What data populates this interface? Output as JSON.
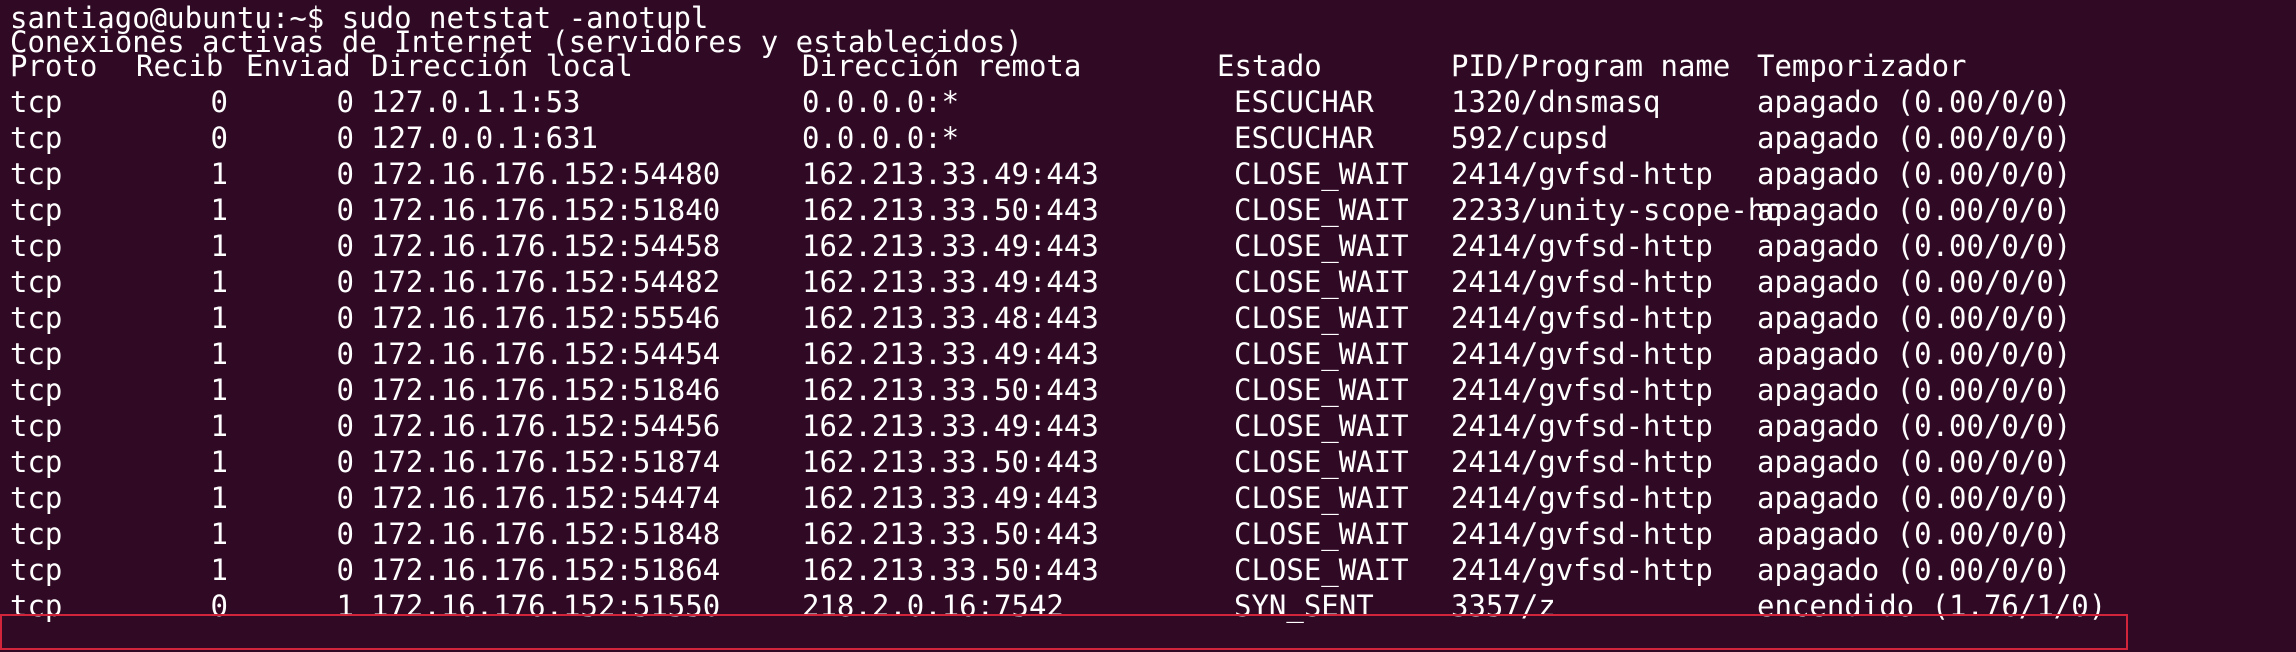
{
  "prompt": "santiago@ubuntu:~$ sudo netstat -anotupl",
  "header_line": "Conexiones activas de Internet (servidores y establecidos)",
  "columns": {
    "proto": "Proto",
    "recib": "Recib",
    "enviad": "Enviad",
    "local": "Dirección local",
    "remote": "Dirección remota",
    "state": "Estado",
    "pid": "PID/Program name",
    "timer": "Temporizador"
  },
  "rows": [
    {
      "proto": "tcp",
      "recib": "0",
      "enviad": "0",
      "local": "127.0.1.1:53",
      "remote": "0.0.0.0:*",
      "state": "ESCUCHAR",
      "pid": "1320/dnsmasq",
      "timer": "apagado (0.00/0/0)"
    },
    {
      "proto": "tcp",
      "recib": "0",
      "enviad": "0",
      "local": "127.0.0.1:631",
      "remote": "0.0.0.0:*",
      "state": "ESCUCHAR",
      "pid": "592/cupsd",
      "timer": "apagado (0.00/0/0)"
    },
    {
      "proto": "tcp",
      "recib": "1",
      "enviad": "0",
      "local": "172.16.176.152:54480",
      "remote": "162.213.33.49:443",
      "state": "CLOSE_WAIT",
      "pid": "2414/gvfsd-http",
      "timer": "apagado (0.00/0/0)"
    },
    {
      "proto": "tcp",
      "recib": "1",
      "enviad": "0",
      "local": "172.16.176.152:51840",
      "remote": "162.213.33.50:443",
      "state": "CLOSE_WAIT",
      "pid": "2233/unity-scope-ho",
      "timer": "apagado (0.00/0/0)"
    },
    {
      "proto": "tcp",
      "recib": "1",
      "enviad": "0",
      "local": "172.16.176.152:54458",
      "remote": "162.213.33.49:443",
      "state": "CLOSE_WAIT",
      "pid": "2414/gvfsd-http",
      "timer": "apagado (0.00/0/0)"
    },
    {
      "proto": "tcp",
      "recib": "1",
      "enviad": "0",
      "local": "172.16.176.152:54482",
      "remote": "162.213.33.49:443",
      "state": "CLOSE_WAIT",
      "pid": "2414/gvfsd-http",
      "timer": "apagado (0.00/0/0)"
    },
    {
      "proto": "tcp",
      "recib": "1",
      "enviad": "0",
      "local": "172.16.176.152:55546",
      "remote": "162.213.33.48:443",
      "state": "CLOSE_WAIT",
      "pid": "2414/gvfsd-http",
      "timer": "apagado (0.00/0/0)"
    },
    {
      "proto": "tcp",
      "recib": "1",
      "enviad": "0",
      "local": "172.16.176.152:54454",
      "remote": "162.213.33.49:443",
      "state": "CLOSE_WAIT",
      "pid": "2414/gvfsd-http",
      "timer": "apagado (0.00/0/0)"
    },
    {
      "proto": "tcp",
      "recib": "1",
      "enviad": "0",
      "local": "172.16.176.152:51846",
      "remote": "162.213.33.50:443",
      "state": "CLOSE_WAIT",
      "pid": "2414/gvfsd-http",
      "timer": "apagado (0.00/0/0)"
    },
    {
      "proto": "tcp",
      "recib": "1",
      "enviad": "0",
      "local": "172.16.176.152:54456",
      "remote": "162.213.33.49:443",
      "state": "CLOSE_WAIT",
      "pid": "2414/gvfsd-http",
      "timer": "apagado (0.00/0/0)"
    },
    {
      "proto": "tcp",
      "recib": "1",
      "enviad": "0",
      "local": "172.16.176.152:51874",
      "remote": "162.213.33.50:443",
      "state": "CLOSE_WAIT",
      "pid": "2414/gvfsd-http",
      "timer": "apagado (0.00/0/0)"
    },
    {
      "proto": "tcp",
      "recib": "1",
      "enviad": "0",
      "local": "172.16.176.152:54474",
      "remote": "162.213.33.49:443",
      "state": "CLOSE_WAIT",
      "pid": "2414/gvfsd-http",
      "timer": "apagado (0.00/0/0)"
    },
    {
      "proto": "tcp",
      "recib": "1",
      "enviad": "0",
      "local": "172.16.176.152:51848",
      "remote": "162.213.33.50:443",
      "state": "CLOSE_WAIT",
      "pid": "2414/gvfsd-http",
      "timer": "apagado (0.00/0/0)"
    },
    {
      "proto": "tcp",
      "recib": "1",
      "enviad": "0",
      "local": "172.16.176.152:51864",
      "remote": "162.213.33.50:443",
      "state": "CLOSE_WAIT",
      "pid": "2414/gvfsd-http",
      "timer": "apagado (0.00/0/0)"
    },
    {
      "proto": "tcp",
      "recib": "0",
      "enviad": "1",
      "local": "172.16.176.152:51550",
      "remote": "218.2.0.16:7542",
      "state": "SYN_SENT",
      "pid": "3357/z",
      "timer": "encendido (1.76/1/0)"
    }
  ],
  "colors": {
    "background": "#300a24",
    "text": "#ffffff",
    "highlight": "#d0253a"
  }
}
